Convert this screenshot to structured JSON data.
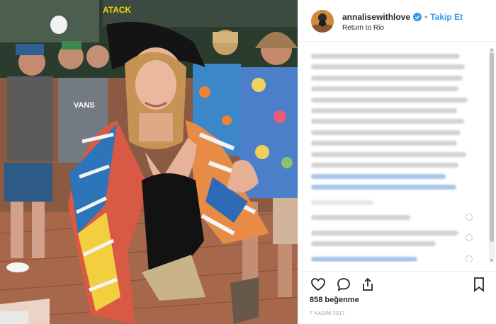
{
  "post": {
    "username": "annalisewithlove",
    "follow_label": "Takip Et",
    "location": "Return to Rio",
    "likes": "858 beğenme",
    "date": "7 KASIM 2017"
  },
  "photo": {
    "sign_text": "ATACK"
  },
  "icons": {
    "like": "heart-icon",
    "comment": "comment-icon",
    "share": "share-icon",
    "save": "bookmark-icon",
    "verified": "verified-badge-icon"
  },
  "colors": {
    "accent": "#3897f0",
    "text": "#262626",
    "muted": "#999999",
    "border": "#efefef"
  }
}
